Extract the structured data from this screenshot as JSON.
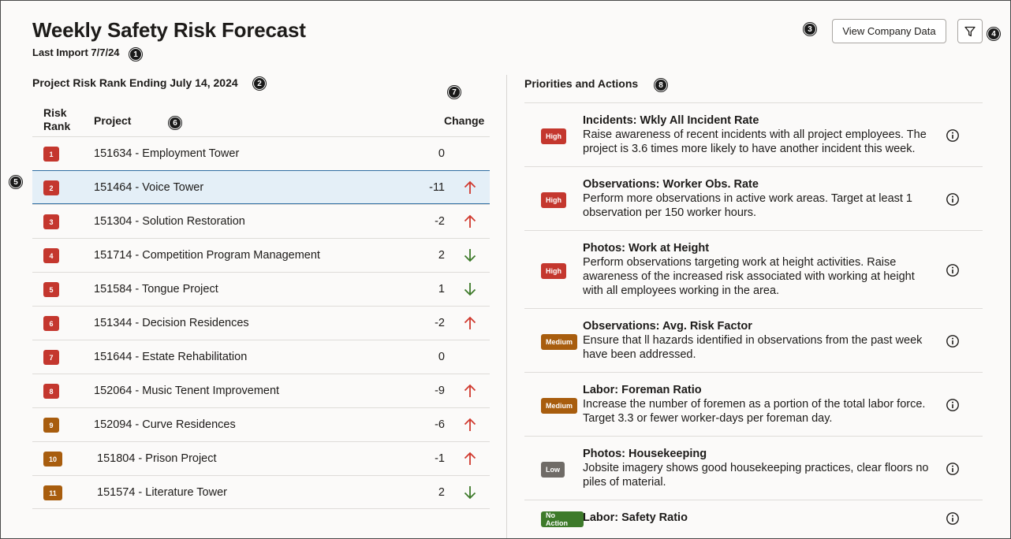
{
  "header": {
    "title": "Weekly Safety Risk Forecast",
    "last_import": "Last Import 7/7/24",
    "company_button": "View Company Data",
    "filter_icon": "filter-icon"
  },
  "callouts": [
    "1",
    "2",
    "3",
    "4",
    "5",
    "6",
    "7",
    "8"
  ],
  "risk_table": {
    "title": "Project Risk Rank Ending July 14, 2024",
    "col_rank": "Risk Rank",
    "col_project": "Project",
    "col_change": "Change",
    "rows": [
      {
        "rank": "1",
        "project": "151634 - Employment Tower",
        "change": "0",
        "direction": "none",
        "color": "#c4372e"
      },
      {
        "rank": "2",
        "project": "151464 - Voice Tower",
        "change": "-11",
        "direction": "up",
        "color": "#c4372e"
      },
      {
        "rank": "3",
        "project": "151304 - Solution Restoration",
        "change": "-2",
        "direction": "up",
        "color": "#c4372e"
      },
      {
        "rank": "4",
        "project": "151714 - Competition Program Management",
        "change": "2",
        "direction": "down",
        "color": "#c4372e"
      },
      {
        "rank": "5",
        "project": "151584 - Tongue Project",
        "change": "1",
        "direction": "down",
        "color": "#c4372e"
      },
      {
        "rank": "6",
        "project": "151344 - Decision Residences",
        "change": "-2",
        "direction": "up",
        "color": "#c4372e"
      },
      {
        "rank": "7",
        "project": "151644 - Estate Rehabilitation",
        "change": "0",
        "direction": "none",
        "color": "#c4372e"
      },
      {
        "rank": "8",
        "project": "152064 - Music Tenent Improvement",
        "change": "-9",
        "direction": "up",
        "color": "#c4372e"
      },
      {
        "rank": "9",
        "project": "152094 - Curve Residences",
        "change": "-6",
        "direction": "up",
        "color": "#a85d0e"
      },
      {
        "rank": "10",
        "project": "151804 - Prison Project",
        "change": "-1",
        "direction": "up",
        "color": "#a85d0e"
      },
      {
        "rank": "11",
        "project": "151574 - Literature Tower",
        "change": "2",
        "direction": "down",
        "color": "#a85d0e"
      }
    ]
  },
  "priorities": {
    "title": "Priorities and Actions",
    "items": [
      {
        "level": "High",
        "color": "#c4372e",
        "title": "Incidents: Wkly All Incident Rate",
        "text": "Raise awareness of recent incidents with all project employees. The project is 3.6 times more likely to have another incident this week."
      },
      {
        "level": "High",
        "color": "#c4372e",
        "title": "Observations: Worker Obs. Rate",
        "text": "Perform more observations in active work areas. Target at least 1 observation per 150 worker hours."
      },
      {
        "level": "High",
        "color": "#c4372e",
        "title": "Photos: Work at Height",
        "text": "Perform observations targeting work at height activities. Raise awareness of the increased risk associated with working at height with all employees working in the area."
      },
      {
        "level": "Medium",
        "color": "#a85d0e",
        "title": "Observations: Avg. Risk Factor",
        "text": "Ensure that ll hazards identified in observations from the past week have been addressed."
      },
      {
        "level": "Medium",
        "color": "#a85d0e",
        "title": "Labor: Foreman Ratio",
        "text": "Increase the number of foremen as a portion of the total labor force. Target 3.3 or fewer worker-days per foreman day."
      },
      {
        "level": "Low",
        "color": "#6f6b67",
        "title": "Photos: Housekeeping",
        "text": "Jobsite imagery shows good housekeeping practices, clear floors no piles of material."
      },
      {
        "level": "No Action",
        "color": "#3d7a2a",
        "title": "Labor: Safety Ratio",
        "text": ""
      }
    ]
  },
  "colors": {
    "arrow_up": "#d0392e",
    "arrow_down": "#3d7a2a",
    "selected_row": "#e4eff7"
  }
}
